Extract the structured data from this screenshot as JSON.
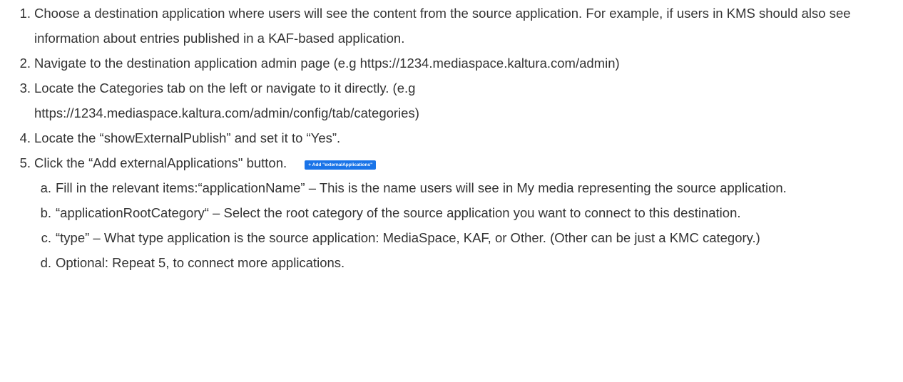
{
  "steps": [
    {
      "num": "1",
      "text": "Choose a destination application where users will see the content from the source application. For example, if users in KMS should also see information about entries published in a KAF-based application."
    },
    {
      "num": "2",
      "text": "Navigate to the destination application admin page (e.g https://1234.mediaspace.kaltura.com/admin)"
    },
    {
      "num": "3",
      "text": "Locate the Categories tab on the left or navigate to it directly. (e.g https://1234.mediaspace.kaltura.com/admin/config/tab/categories)"
    },
    {
      "num": "4",
      "text": "Locate the “showExternalPublish” and set it to “Yes”."
    },
    {
      "num": "5",
      "text": "Click the “Add externalApplications\" button."
    }
  ],
  "add_button_label": "+ Add \"externalApplications\"",
  "substeps": [
    {
      "num": "a",
      "text": "Fill in the relevant items:“applicationName” – This is the name users will see in My media representing the source application."
    },
    {
      "num": "b",
      "text": "“applicationRootCategory“ – Select the root category of the source application you want to connect to this destination."
    },
    {
      "num": "c",
      "text": "“type” – What type application is the source application: MediaSpace, KAF, or Other. (Other can be just a KMC category.)"
    },
    {
      "num": "d",
      "text": "Optional: Repeat 5, to connect more applications."
    }
  ],
  "colors": {
    "text": "#333333",
    "button_bg": "#1a74e8",
    "button_text": "#ffffff"
  }
}
